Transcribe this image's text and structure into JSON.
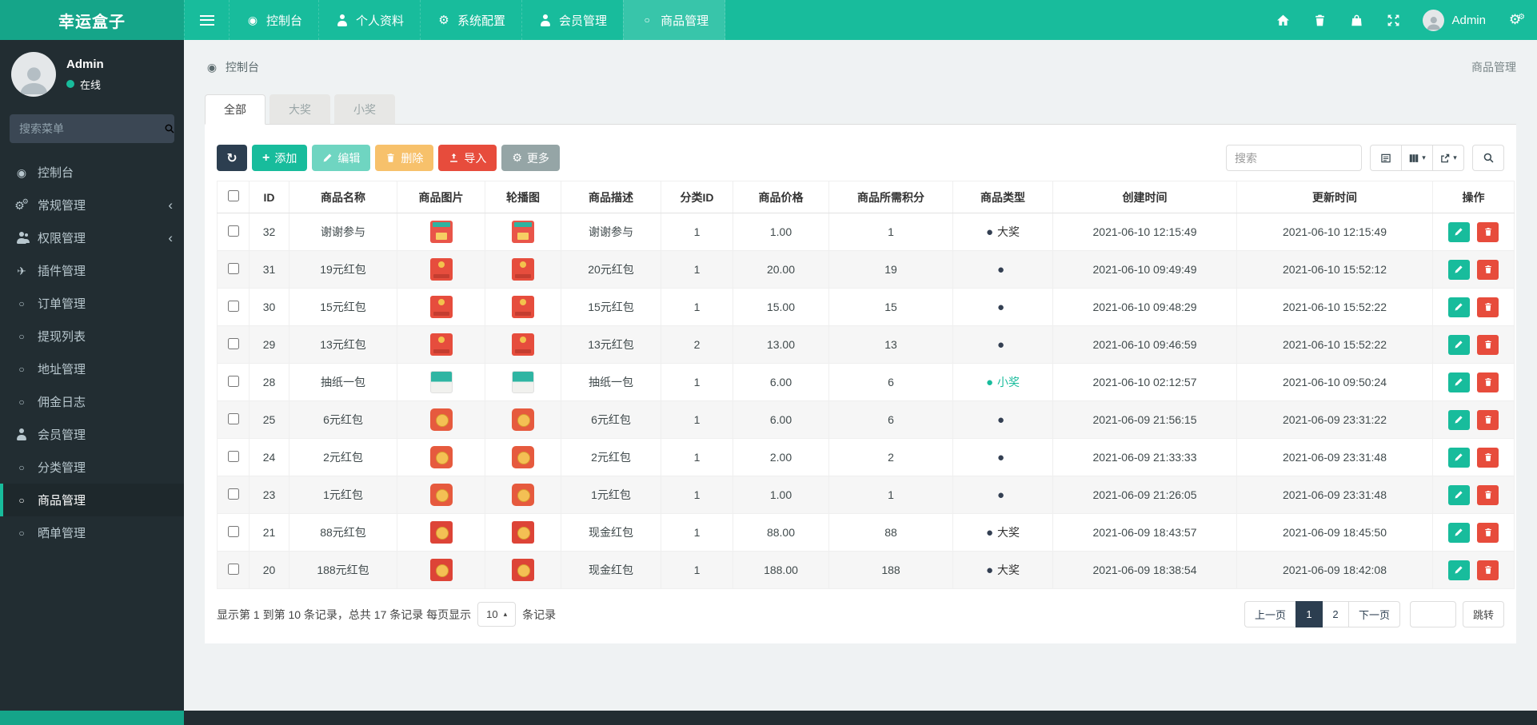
{
  "brand": "幸运盒子",
  "colors": {
    "accent": "#18bc9c",
    "dark": "#2c3e50",
    "danger": "#e74c3c",
    "warning": "#f39c12",
    "gray": "#95a5a6",
    "sidebar_bg": "#222d32"
  },
  "topnav": {
    "items": [
      {
        "label": "控制台",
        "icon": "dashboard"
      },
      {
        "label": "个人资料",
        "icon": "user"
      },
      {
        "label": "系统配置",
        "icon": "gear"
      },
      {
        "label": "会员管理",
        "icon": "user"
      },
      {
        "label": "商品管理",
        "icon": "circle",
        "active": true
      }
    ],
    "right_icons": [
      {
        "icon": "home",
        "name": "home-icon-button"
      },
      {
        "icon": "trash",
        "name": "clear-cache-icon-button"
      },
      {
        "icon": "shop",
        "name": "shop-icon-button"
      },
      {
        "icon": "fullscreen",
        "name": "fullscreen-icon-button"
      }
    ],
    "user_name": "Admin"
  },
  "sidebar": {
    "user_name": "Admin",
    "user_status": "在线",
    "search_placeholder": "搜索菜单",
    "items": [
      {
        "label": "控制台",
        "icon": "dashboard"
      },
      {
        "label": "常规管理",
        "icon": "cogs",
        "chevron": true
      },
      {
        "label": "权限管理",
        "icon": "users",
        "chevron": true
      },
      {
        "label": "插件管理",
        "icon": "rocket"
      },
      {
        "label": "订单管理",
        "icon": "circle"
      },
      {
        "label": "提现列表",
        "icon": "circle"
      },
      {
        "label": "地址管理",
        "icon": "circle"
      },
      {
        "label": "佣金日志",
        "icon": "circle"
      },
      {
        "label": "会员管理",
        "icon": "user"
      },
      {
        "label": "分类管理",
        "icon": "circle"
      },
      {
        "label": "商品管理",
        "icon": "circle",
        "active": true
      },
      {
        "label": "晒单管理",
        "icon": "circle"
      }
    ]
  },
  "breadcrumb": {
    "left": "控制台",
    "right": "商品管理"
  },
  "tabs": [
    {
      "label": "全部",
      "active": true
    },
    {
      "label": "大奖"
    },
    {
      "label": "小奖"
    }
  ],
  "toolbar": {
    "add_label": "添加",
    "edit_label": "编辑",
    "delete_label": "删除",
    "import_label": "导入",
    "more_label": "更多",
    "search_placeholder": "搜索"
  },
  "table": {
    "columns": [
      "ID",
      "商品名称",
      "商品图片",
      "轮播图",
      "商品描述",
      "分类ID",
      "商品价格",
      "商品所需积分",
      "商品类型",
      "创建时间",
      "更新时间",
      "操作"
    ],
    "rows": [
      {
        "id": "32",
        "name": "谢谢参与",
        "thumb": "banner",
        "desc": "谢谢参与",
        "cat": "1",
        "price": "1.00",
        "score": "1",
        "type": "大奖",
        "type_color": "dark",
        "created": "2021-06-10 12:15:49",
        "updated": "2021-06-10 12:15:49"
      },
      {
        "id": "31",
        "name": "19元红包",
        "thumb": "envelope",
        "desc": "20元红包",
        "cat": "1",
        "price": "20.00",
        "score": "19",
        "type": "",
        "type_color": "dark",
        "created": "2021-06-10 09:49:49",
        "updated": "2021-06-10 15:52:12"
      },
      {
        "id": "30",
        "name": "15元红包",
        "thumb": "envelope",
        "desc": "15元红包",
        "cat": "1",
        "price": "15.00",
        "score": "15",
        "type": "",
        "type_color": "dark",
        "created": "2021-06-10 09:48:29",
        "updated": "2021-06-10 15:52:22"
      },
      {
        "id": "29",
        "name": "13元红包",
        "thumb": "envelope",
        "desc": "13元红包",
        "cat": "2",
        "price": "13.00",
        "score": "13",
        "type": "",
        "type_color": "dark",
        "created": "2021-06-10 09:46:59",
        "updated": "2021-06-10 15:52:22"
      },
      {
        "id": "28",
        "name": "抽纸一包",
        "thumb": "tissue",
        "desc": "抽纸一包",
        "cat": "1",
        "price": "6.00",
        "score": "6",
        "type": "小奖",
        "type_color": "green",
        "created": "2021-06-10 02:12:57",
        "updated": "2021-06-10 09:50:24"
      },
      {
        "id": "25",
        "name": "6元红包",
        "thumb": "coin-round",
        "desc": "6元红包",
        "cat": "1",
        "price": "6.00",
        "score": "6",
        "type": "",
        "type_color": "dark",
        "created": "2021-06-09 21:56:15",
        "updated": "2021-06-09 23:31:22"
      },
      {
        "id": "24",
        "name": "2元红包",
        "thumb": "coin-round",
        "desc": "2元红包",
        "cat": "1",
        "price": "2.00",
        "score": "2",
        "type": "",
        "type_color": "dark",
        "created": "2021-06-09 21:33:33",
        "updated": "2021-06-09 23:31:48"
      },
      {
        "id": "23",
        "name": "1元红包",
        "thumb": "coin-round",
        "desc": "1元红包",
        "cat": "1",
        "price": "1.00",
        "score": "1",
        "type": "",
        "type_color": "dark",
        "created": "2021-06-09 21:26:05",
        "updated": "2021-06-09 23:31:48"
      },
      {
        "id": "21",
        "name": "88元红包",
        "thumb": "coin-square",
        "desc": "现金红包",
        "cat": "1",
        "price": "88.00",
        "score": "88",
        "type": "大奖",
        "type_color": "dark",
        "created": "2021-06-09 18:43:57",
        "updated": "2021-06-09 18:45:50"
      },
      {
        "id": "20",
        "name": "188元红包",
        "thumb": "coin-square",
        "desc": "现金红包",
        "cat": "1",
        "price": "188.00",
        "score": "188",
        "type": "大奖",
        "type_color": "dark",
        "created": "2021-06-09 18:38:54",
        "updated": "2021-06-09 18:42:08"
      }
    ]
  },
  "pagination": {
    "info_prefix": "显示第 1 到第 10 条记录，总共 17 条记录 每页显示",
    "page_size": "10",
    "info_suffix": "条记录",
    "prev_label": "上一页",
    "pages": [
      {
        "label": "1",
        "active": true
      },
      {
        "label": "2"
      }
    ],
    "next_label": "下一页",
    "jump_label": "跳转"
  }
}
